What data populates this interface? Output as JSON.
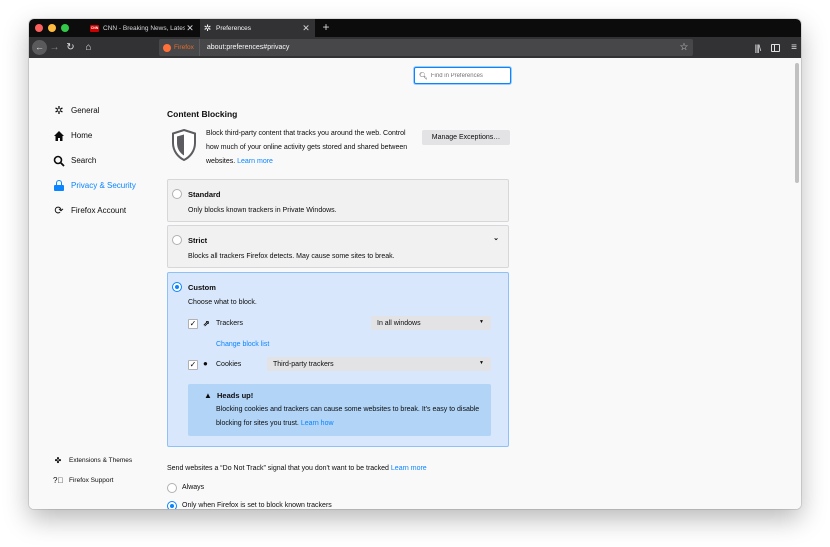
{
  "tabs": [
    {
      "title": "CNN - Breaking News, Latest N",
      "favicon": "CNN",
      "close": "✕"
    },
    {
      "title": "Preferences",
      "close": "✕"
    }
  ],
  "new_tab": "+",
  "nav": {
    "identity_label": "Firefox",
    "url": "about:preferences#privacy"
  },
  "search": {
    "placeholder": "Find in Preferences"
  },
  "categories": [
    {
      "label": "General",
      "icon": "gear-icon"
    },
    {
      "label": "Home",
      "icon": "home-icon"
    },
    {
      "label": "Search",
      "icon": "search-icon"
    },
    {
      "label": "Privacy & Security",
      "icon": "lock-icon",
      "selected": true
    },
    {
      "label": "Firefox Account",
      "icon": "sync-icon"
    }
  ],
  "footer_links": [
    {
      "label": "Extensions & Themes",
      "icon": "puzzle-icon"
    },
    {
      "label": "Firefox Support",
      "icon": "help-icon"
    }
  ],
  "content_blocking": {
    "heading": "Content Blocking",
    "intro": "Block third-party content that tracks you around the web. Control how much of your online activity gets stored and shared between websites.",
    "learn_more": "Learn more",
    "manage_button": "Manage Exceptions…",
    "standard": {
      "title": "Standard",
      "desc": "Only blocks known trackers in Private Windows."
    },
    "strict": {
      "title": "Strict",
      "desc": "Blocks all trackers Firefox detects. May cause some sites to break."
    },
    "custom": {
      "title": "Custom",
      "desc": "Choose what to block.",
      "trackers_label": "Trackers",
      "trackers_select": "In all windows",
      "change_block_list": "Change block list",
      "cookies_label": "Cookies",
      "cookies_select": "Third-party trackers",
      "headsup_title": "Heads up!",
      "headsup_text": "Blocking cookies and trackers can cause some websites to break. It's easy to disable blocking for sites you trust.",
      "learn_how": "Learn how"
    }
  },
  "dnt": {
    "text": "Send websites a “Do Not Track” signal that you don't want to be tracked",
    "learn_more": "Learn more",
    "always": "Always",
    "only_when": "Only when Firefox is set to block known trackers"
  },
  "colors": {
    "accent": "#0a84ff",
    "tab_strip": "#0c0c0d",
    "toolbar": "#323234",
    "custom_panel": "#d8e7fb"
  }
}
